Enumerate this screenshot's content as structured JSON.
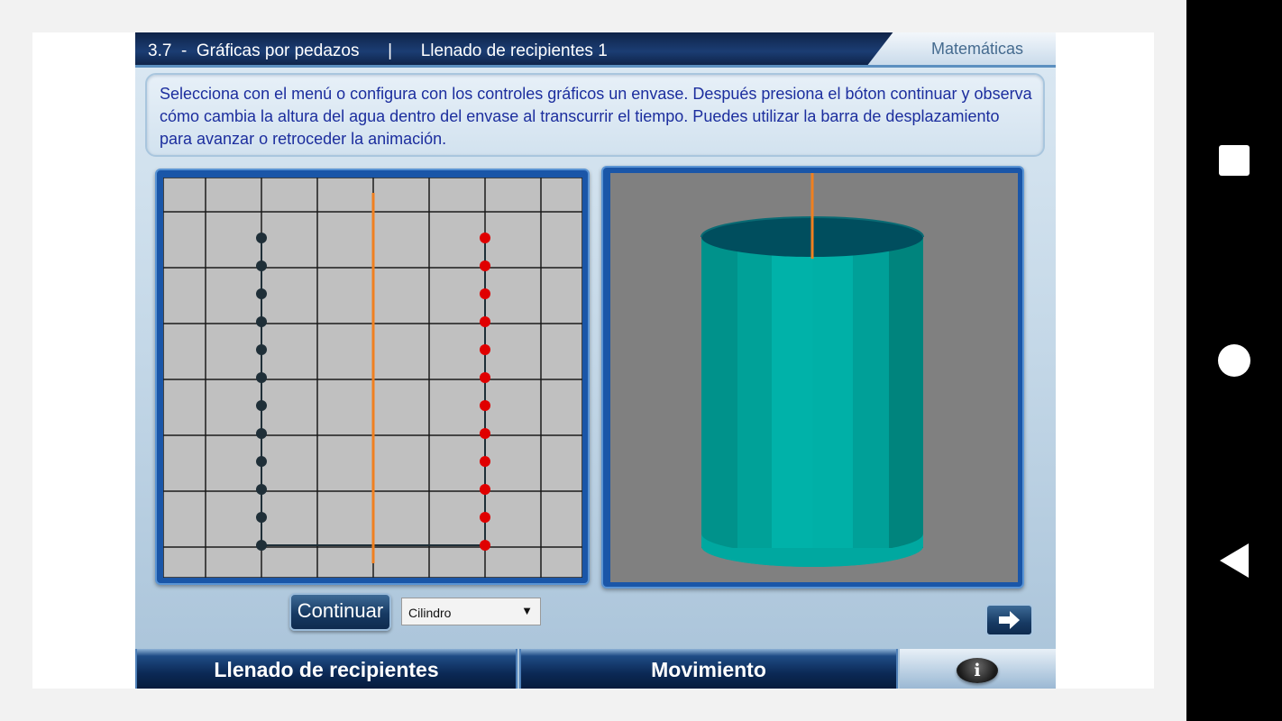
{
  "header": {
    "title": "3.7  -  Gráficas por pedazos      |      Llenado de recipientes 1",
    "brand": "Matemáticas"
  },
  "instructions": {
    "text": "Selecciona con el menú  o  configura con los controles  gráficos  un  envase.  Después  presiona  el bóton continuar y observa cómo cambia la altura del agua dentro del envase al transcurrir el tiempo. Puedes utilizar la barra de desplazamiento  para avanzar o retroceder la animación."
  },
  "graph": {
    "dark_points_count": 12,
    "red_points_count": 12,
    "colors": {
      "background": "#c0c0c0",
      "grid": "#1a1a1a",
      "dark_points": "#1f2f38",
      "red_points": "#e00000",
      "time_marker": "#f08020"
    }
  },
  "view3d": {
    "shape": "cylinder",
    "colors": {
      "background": "#808080",
      "cylinder": "#00a8a0",
      "marker": "#f08020"
    }
  },
  "controls": {
    "continue_label": "Continuar",
    "shape_select_value": "Cilindro",
    "dropdown_icon": "▼",
    "next_icon": "arrow-right-icon"
  },
  "bottom_nav": {
    "tabs": [
      {
        "label": "Llenado de recipientes"
      },
      {
        "label": "Movimiento"
      }
    ],
    "info_icon": "i"
  },
  "system_nav": {
    "buttons": [
      "recents-square-icon",
      "home-circle-icon",
      "back-triangle-icon"
    ]
  }
}
